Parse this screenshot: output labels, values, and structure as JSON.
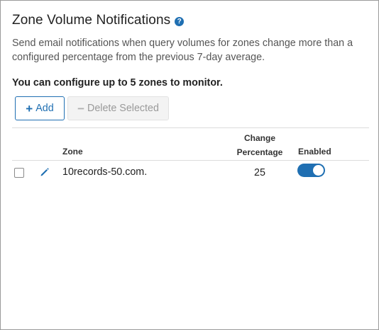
{
  "header": {
    "title": "Zone Volume Notifications",
    "help_glyph": "?",
    "description": "Send email notifications when query volumes for zones change more than a configured percentage from the previous 7-day average.",
    "limit_note": "You can configure up to 5 zones to monitor."
  },
  "toolbar": {
    "add_icon": "+",
    "add_label": "Add",
    "delete_icon": "−",
    "delete_label": "Delete Selected"
  },
  "table": {
    "columns": {
      "zone": "Zone",
      "change_line1": "Change",
      "change_line2": "Percentage",
      "enabled": "Enabled"
    },
    "rows": [
      {
        "zone": "10records-50.com.",
        "change_percentage": "25",
        "enabled": true,
        "selected": false
      }
    ]
  },
  "colors": {
    "accent": "#1f6fb2",
    "border": "#9a9a9a",
    "disabled_text": "#9a9a9a"
  },
  "icons": {
    "help": "question-circle-icon",
    "add": "plus-icon",
    "delete": "minus-icon",
    "edit": "pencil-icon"
  }
}
